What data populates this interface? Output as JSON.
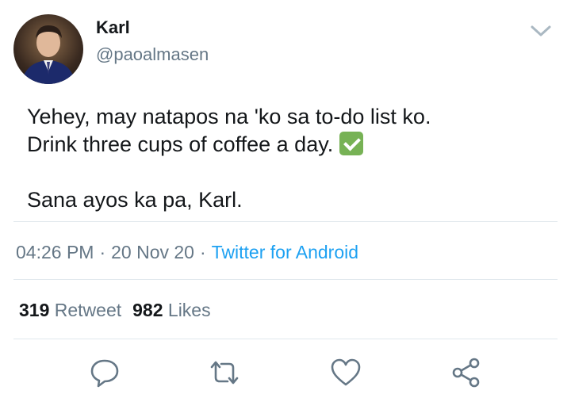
{
  "user": {
    "name": "Karl",
    "handle": "@paoalmasen"
  },
  "tweet": {
    "line1": "Yehey, may natapos na 'ko sa to-do list ko.",
    "line2": "Drink three cups of coffee a day. ",
    "line3": "Sana ayos ka pa, Karl."
  },
  "meta": {
    "time": "04:26 PM",
    "date": "20 Nov 20",
    "separator": "·",
    "source": "Twitter for Android"
  },
  "stats": {
    "retweet_count": "319",
    "retweet_label": "Retweet",
    "likes_count": "982",
    "likes_label": "Likes"
  },
  "colors": {
    "accent": "#1da1f2",
    "secondary_text": "#657786",
    "divider": "#e1e8ed",
    "check": "#77b255"
  },
  "icons": {
    "reply": "speech-bubble-icon",
    "retweet": "retweet-arrows-icon",
    "like": "heart-icon",
    "share": "share-nodes-icon",
    "menu": "chevron-down-icon",
    "emoji": "check-mark-button-icon"
  }
}
